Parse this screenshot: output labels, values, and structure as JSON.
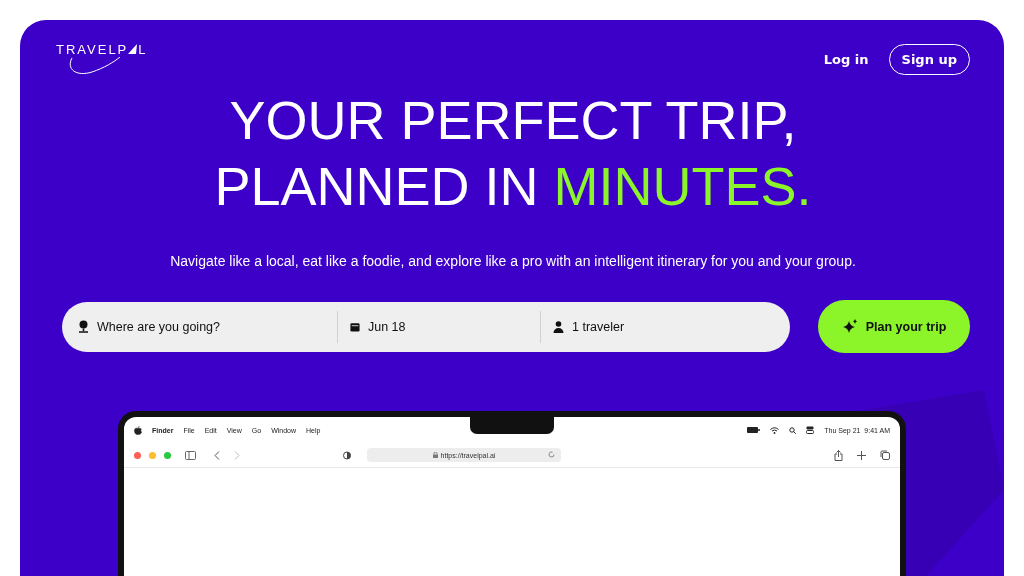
{
  "logo": {
    "before": "TRAVELP",
    "after": "L"
  },
  "nav": [
    {
      "label": "Log in",
      "kind": "link"
    },
    {
      "label": "Sign up",
      "kind": "outline"
    }
  ],
  "headline": [
    [
      {
        "text": "YOUR PERFECT TRIP,",
        "highlight": false
      }
    ],
    [
      {
        "text": "PLANNED IN ",
        "highlight": false
      },
      {
        "text": "MINUTES.",
        "highlight": true
      }
    ]
  ],
  "subtitle": "Navigate like a local, eat like a foodie, and explore like a pro with an intelligent itinerary for you and your group.",
  "search": {
    "fields": [
      {
        "kind": "destination",
        "placeholder": "Where are you going?"
      },
      {
        "kind": "date",
        "value": "Jun 18"
      },
      {
        "kind": "travelers",
        "value": "1 traveler"
      }
    ],
    "button": "Plan your trip"
  },
  "laptop": {
    "menubar": {
      "app": "Finder",
      "menus": [
        "File",
        "Edit",
        "View",
        "Go",
        "Window",
        "Help"
      ],
      "clock": "Thu Sep 21  9:41 AM"
    },
    "address": "https://travelpal.ai"
  }
}
